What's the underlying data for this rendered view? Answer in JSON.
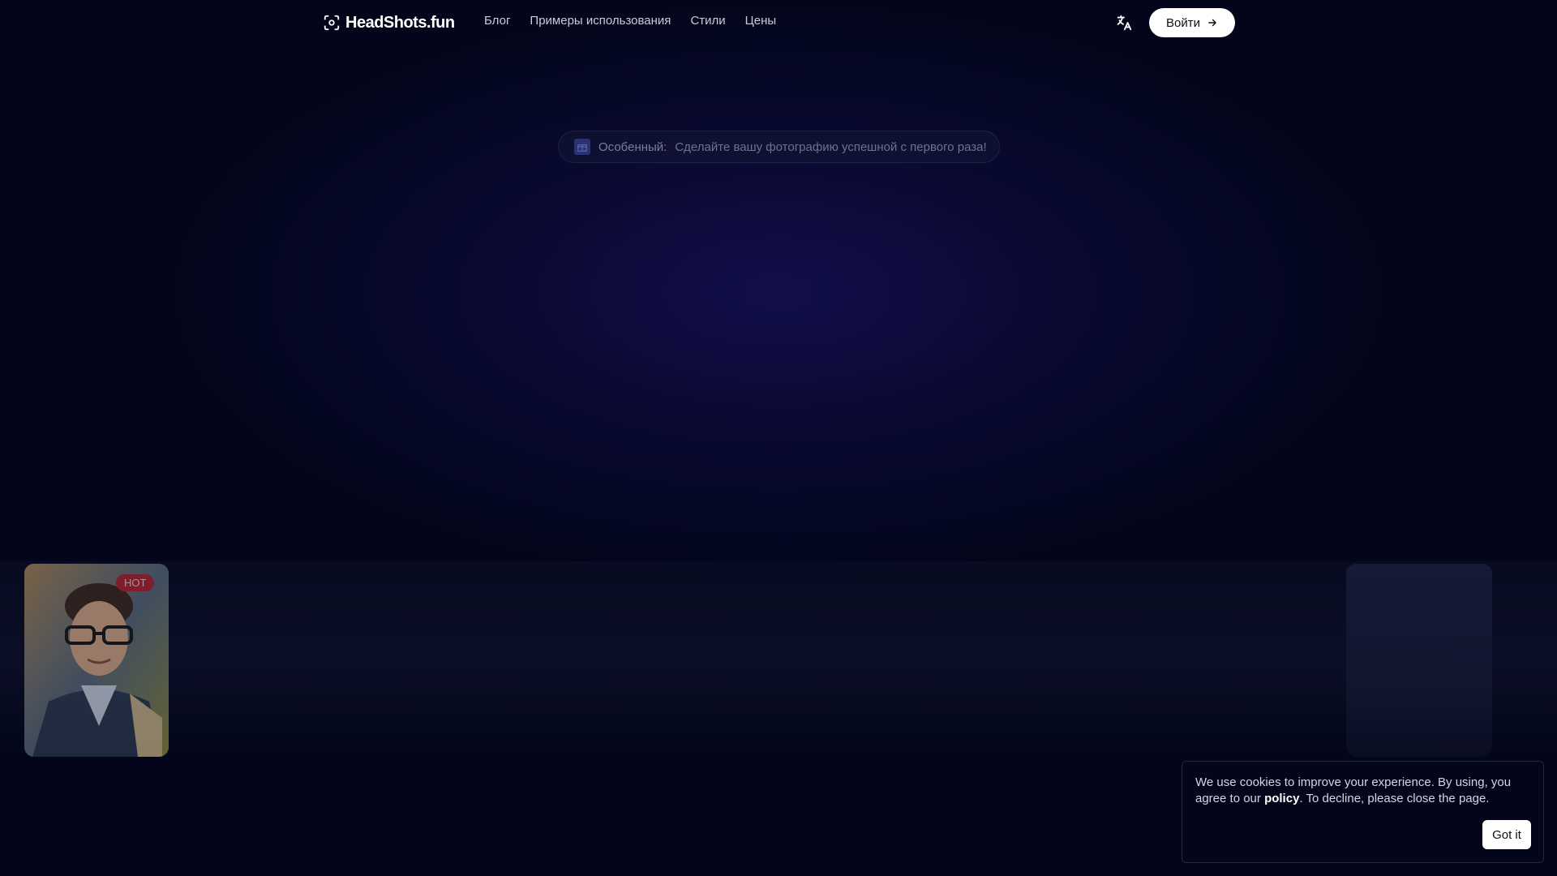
{
  "header": {
    "logo_text": "HeadShots.fun",
    "nav": [
      {
        "label": "Блог"
      },
      {
        "label": "Примеры использования"
      },
      {
        "label": "Стили"
      },
      {
        "label": "Цены"
      }
    ],
    "language_icon": "translate-icon",
    "login_label": "Войти",
    "login_icon": "arrow-right-icon"
  },
  "announcement": {
    "icon": "gift-icon",
    "label": "Особенный:",
    "text": "Сделайте вашу фотографию успешной с первого раза!"
  },
  "gallery": {
    "left_card_badge": "HOT"
  },
  "cookie": {
    "text_before": "We use cookies to improve your experience. By using, you agree to our ",
    "link_text": "policy",
    "text_after": ". To decline, please close the page.",
    "button_label": "Got it"
  },
  "colors": {
    "background": "#03061a",
    "accent_glow": "#120f4a",
    "badge": "#b2252e"
  }
}
